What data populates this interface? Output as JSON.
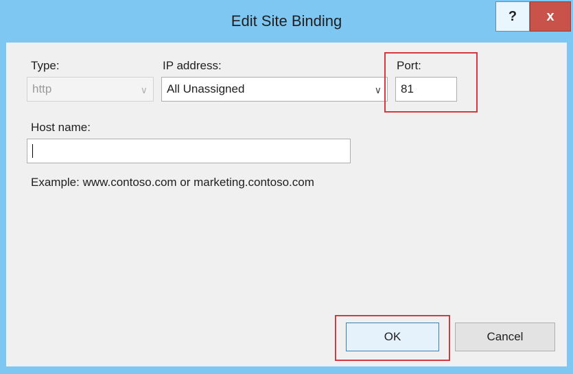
{
  "window": {
    "title": "Edit Site Binding",
    "help_glyph": "?",
    "close_glyph": "x"
  },
  "form": {
    "type": {
      "label": "Type:",
      "value": "http"
    },
    "ip_address": {
      "label": "IP address:",
      "value": "All Unassigned"
    },
    "port": {
      "label": "Port:",
      "value": "81"
    },
    "host_name": {
      "label": "Host name:",
      "value": ""
    },
    "example_text": "Example: www.contoso.com or marketing.contoso.com"
  },
  "buttons": {
    "ok": "OK",
    "cancel": "Cancel"
  },
  "colors": {
    "title_bar": "#7fc7f3",
    "highlight": "#d4373e",
    "close_button": "#c9524a"
  },
  "icons": {
    "dropdown": "chevron-down-icon"
  }
}
